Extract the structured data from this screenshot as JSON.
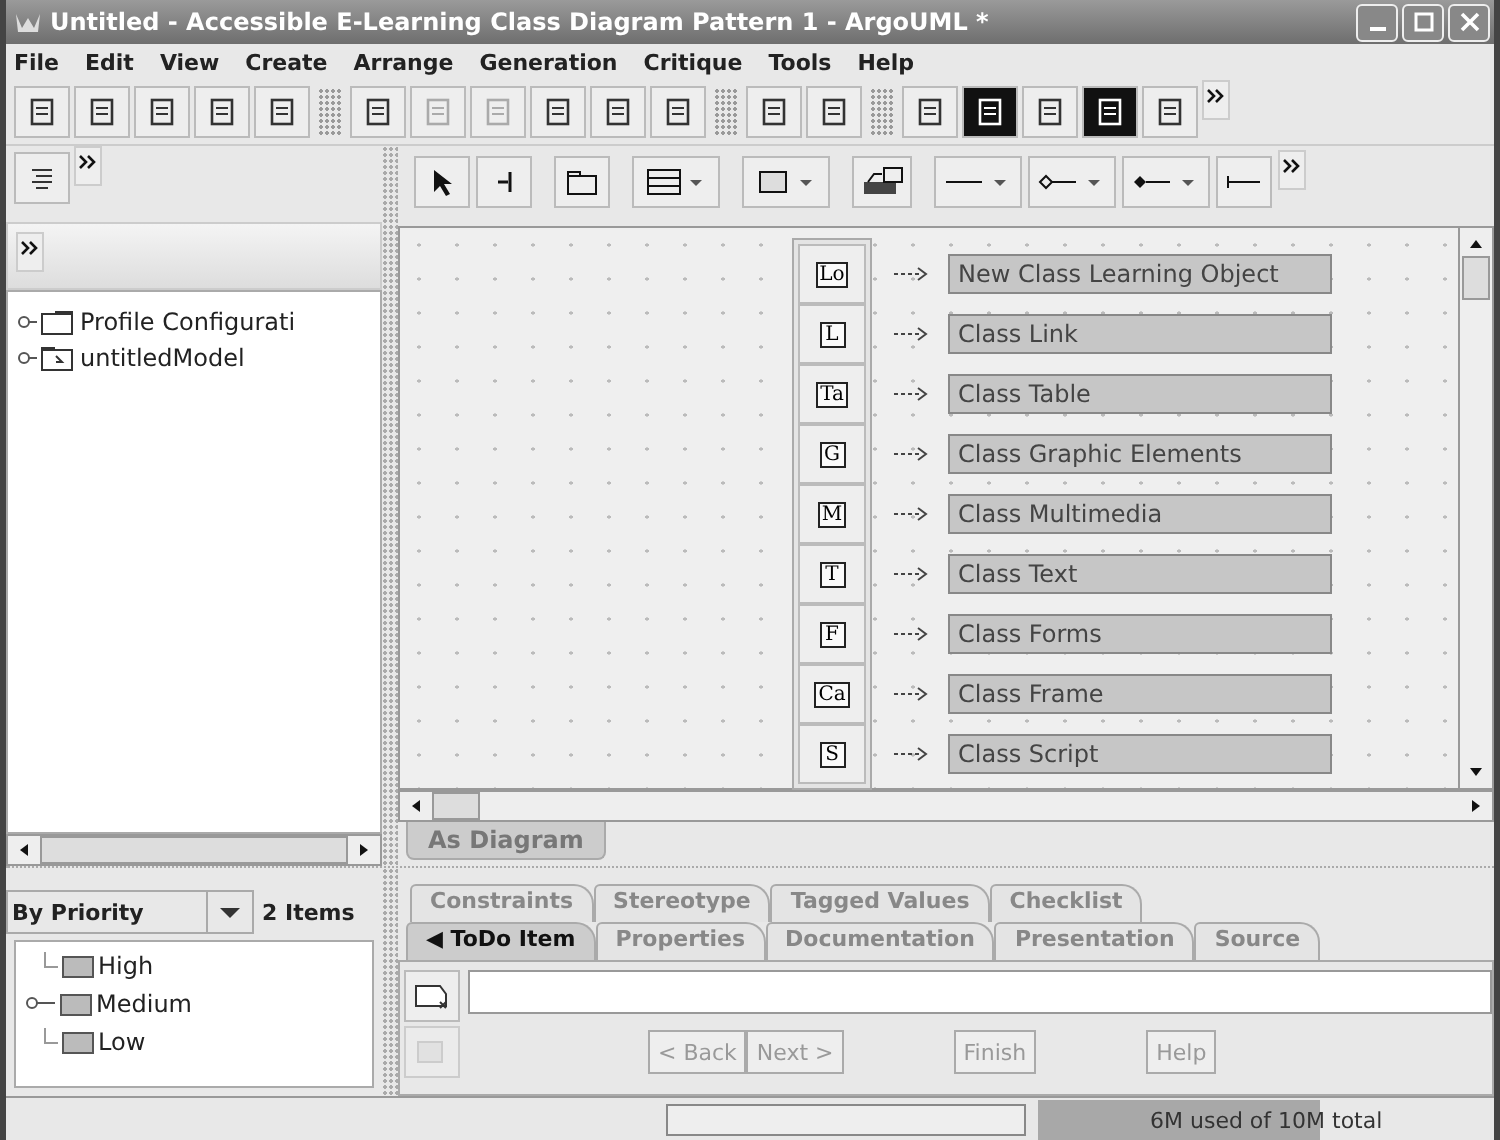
{
  "window": {
    "title": "Untitled - Accessible E-Learning Class Diagram Pattern 1 - ArgoUML *"
  },
  "menu": [
    "File",
    "Edit",
    "View",
    "Create",
    "Arrange",
    "Generation",
    "Critique",
    "Tools",
    "Help"
  ],
  "explorer": {
    "tree": [
      {
        "label": "Profile Configurati",
        "kind": "profile"
      },
      {
        "label": "untitledModel",
        "kind": "model"
      }
    ]
  },
  "diagram": {
    "palette": [
      {
        "icon": "Lo",
        "label": "New Class Learning Object"
      },
      {
        "icon": "L",
        "label": "Class Link"
      },
      {
        "icon": "Ta",
        "label": "Class Table"
      },
      {
        "icon": "G",
        "label": "Class Graphic Elements"
      },
      {
        "icon": "M",
        "label": "Class Multimedia"
      },
      {
        "icon": "T",
        "label": "Class Text"
      },
      {
        "icon": "F",
        "label": "Class Forms"
      },
      {
        "icon": "Ca",
        "label": "Class Frame"
      },
      {
        "icon": "S",
        "label": "Class Script"
      }
    ],
    "tab": "As Diagram"
  },
  "todo": {
    "grouping": "By Priority",
    "count": "2 Items",
    "tree": [
      {
        "label": "High",
        "collapsed": false
      },
      {
        "label": "Medium",
        "collapsed": true
      },
      {
        "label": "Low",
        "collapsed": false
      }
    ]
  },
  "details": {
    "tabs_row1": [
      {
        "label": "Constraints",
        "selected": false
      },
      {
        "label": "Stereotype",
        "selected": false
      },
      {
        "label": "Tagged Values",
        "selected": false
      },
      {
        "label": "Checklist",
        "selected": false
      }
    ],
    "tabs_row2": [
      {
        "label": "◀ ToDo Item",
        "selected": true
      },
      {
        "label": "Properties",
        "selected": false
      },
      {
        "label": "Documentation",
        "selected": false
      },
      {
        "label": "Presentation",
        "selected": false
      },
      {
        "label": "Source",
        "selected": false
      }
    ],
    "buttons": [
      {
        "label": "< Back",
        "disabled": true
      },
      {
        "label": "Next >",
        "disabled": true
      },
      {
        "label": "Finish",
        "disabled": true
      },
      {
        "label": "Help",
        "disabled": true
      }
    ]
  },
  "status_bar": {
    "memory": "6M used of 10M total",
    "level": 0.62
  }
}
